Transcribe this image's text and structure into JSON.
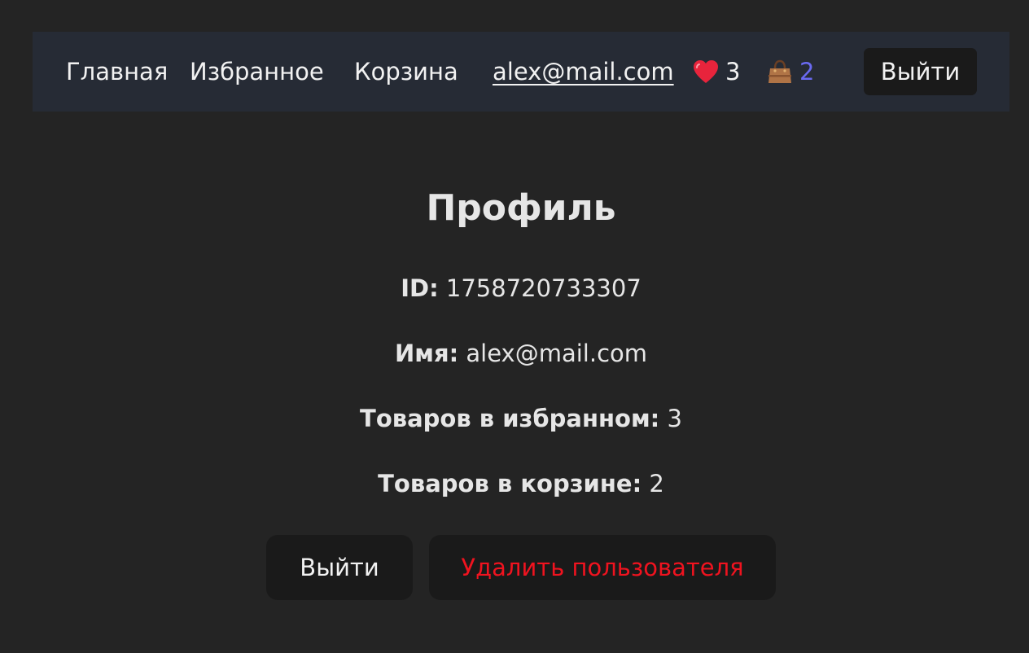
{
  "nav": {
    "home": "Главная",
    "favorites": "Избранное",
    "cart": "Корзина",
    "user_email": "alex@mail.com",
    "favorites_count": "3",
    "cart_count": "2",
    "logout": "Выйти"
  },
  "icons": {
    "favorites": "heart-icon",
    "cart": "shopping-bag-icon"
  },
  "colors": {
    "cart_count": "#6a6af2",
    "delete_button_text": "#f0131f",
    "navbar_bg": "#262b35",
    "heart": "#e8243c"
  },
  "profile": {
    "title": "Профиль",
    "id_label": "ID:",
    "id_value": "1758720733307",
    "name_label": "Имя:",
    "name_value": "alex@mail.com",
    "favorites_label": "Товаров в избранном:",
    "favorites_value": "3",
    "cart_label": "Товаров в корзине:",
    "cart_value": "2",
    "logout_button": "Выйти",
    "delete_button": "Удалить пользователя"
  }
}
